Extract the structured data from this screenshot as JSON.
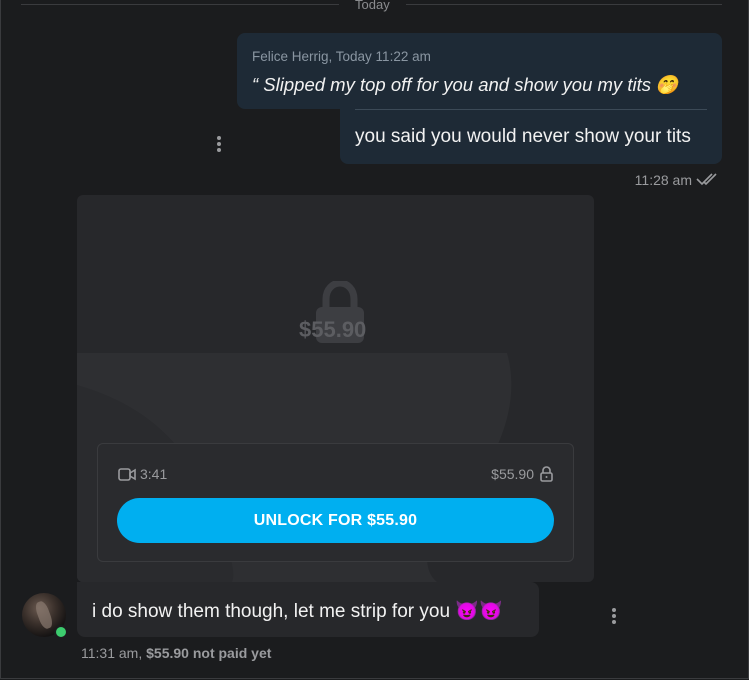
{
  "chat": {
    "day_label": "Today",
    "outgoing": {
      "quote_meta": "Felice Herrig, Today 11:22 am",
      "quote_text": "“ Slipped my top off for you and show you my tits",
      "quote_emoji": "🤭",
      "reply_text": "you said you would never show your tits",
      "timestamp": "11:28 am",
      "read_status_icon": "double-check-icon"
    },
    "media": {
      "price_overlay": "$55.90",
      "duration": "3:41",
      "price": "$55.90",
      "unlock_label": "UNLOCK FOR $55.90",
      "accent_color": "#00aff0"
    },
    "incoming": {
      "text": "i do show them though, let me strip for you 😈😈",
      "timestamp": "11:31 am,",
      "payment_status": "$55.90 not paid yet",
      "online_color": "#3ccc6e"
    }
  }
}
